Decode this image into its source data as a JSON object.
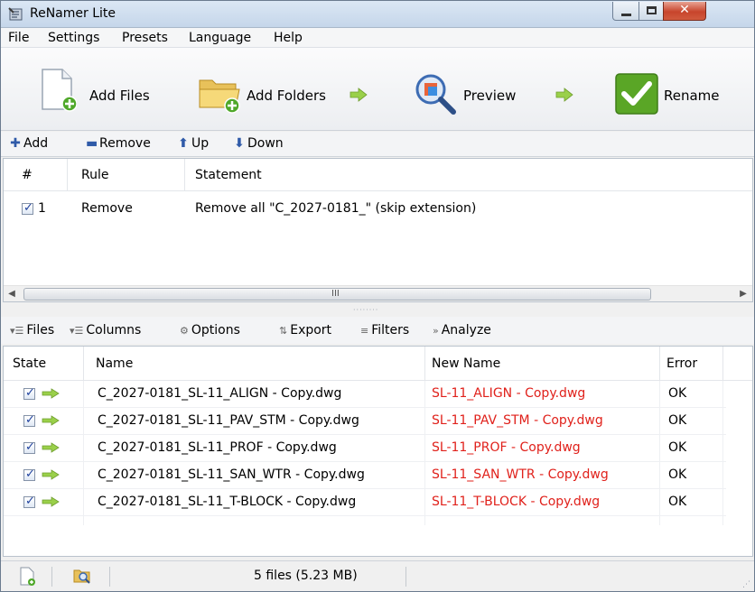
{
  "window": {
    "title": "ReNamer Lite"
  },
  "menu": [
    "File",
    "Settings",
    "Presets",
    "Language",
    "Help"
  ],
  "toolbar": {
    "add_files": "Add Files",
    "add_folders": "Add Folders",
    "preview": "Preview",
    "rename": "Rename"
  },
  "rules_toolbar": {
    "add": "Add",
    "remove": "Remove",
    "up": "Up",
    "down": "Down"
  },
  "rules_table": {
    "columns": [
      "#",
      "Rule",
      "Statement"
    ],
    "rows": [
      {
        "checked": true,
        "num": "1",
        "rule": "Remove",
        "statement": "Remove all \"C_2027-0181_\" (skip extension)"
      }
    ],
    "scroll_marker": "III"
  },
  "files_toolbar": {
    "files": "Files",
    "columns": "Columns",
    "options": "Options",
    "export": "Export",
    "filters": "Filters",
    "analyze": "Analyze"
  },
  "files_table": {
    "columns": [
      "State",
      "Name",
      "New Name",
      "Error"
    ],
    "rows": [
      {
        "checked": true,
        "name": "C_2027-0181_SL-11_ALIGN - Copy.dwg",
        "new_name": "SL-11_ALIGN - Copy.dwg",
        "error": "OK"
      },
      {
        "checked": true,
        "name": "C_2027-0181_SL-11_PAV_STM - Copy.dwg",
        "new_name": "SL-11_PAV_STM - Copy.dwg",
        "error": "OK"
      },
      {
        "checked": true,
        "name": "C_2027-0181_SL-11_PROF - Copy.dwg",
        "new_name": "SL-11_PROF - Copy.dwg",
        "error": "OK"
      },
      {
        "checked": true,
        "name": "C_2027-0181_SL-11_SAN_WTR - Copy.dwg",
        "new_name": "SL-11_SAN_WTR - Copy.dwg",
        "error": "OK"
      },
      {
        "checked": true,
        "name": "C_2027-0181_SL-11_T-BLOCK - Copy.dwg",
        "new_name": "SL-11_T-BLOCK - Copy.dwg",
        "error": "OK"
      }
    ]
  },
  "status": {
    "summary": "5 files (5.23 MB)"
  },
  "colors": {
    "new_name": "#e0211b",
    "accent": "#2f5aa8",
    "go_arrow": "#8cc63f",
    "rename_green": "#5aa626"
  }
}
